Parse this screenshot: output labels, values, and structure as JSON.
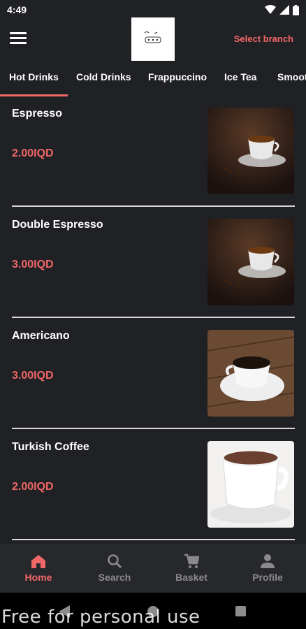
{
  "status": {
    "time": "4:49"
  },
  "header": {
    "branch_link": "Select branch"
  },
  "tabs": [
    {
      "label": "Hot Drinks"
    },
    {
      "label": "Cold Drinks"
    },
    {
      "label": "Frappuccino"
    },
    {
      "label": "Ice Tea"
    },
    {
      "label": "Smoot"
    }
  ],
  "items": [
    {
      "name": "Espresso",
      "price": "2.00IQD",
      "image": "espresso-cup-icon"
    },
    {
      "name": "Double Espresso",
      "price": "3.00IQD",
      "image": "espresso-cup-icon"
    },
    {
      "name": "Americano",
      "price": "3.00IQD",
      "image": "americano-cup-icon"
    },
    {
      "name": "Turkish Coffee",
      "price": "2.00IQD",
      "image": "turkish-coffee-cup-icon"
    }
  ],
  "bottom_nav": [
    {
      "label": "Home",
      "icon": "home-icon"
    },
    {
      "label": "Search",
      "icon": "search-icon"
    },
    {
      "label": "Basket",
      "icon": "cart-icon"
    },
    {
      "label": "Profile",
      "icon": "person-icon"
    }
  ],
  "colors": {
    "accent": "#f06767",
    "background": "#202125",
    "nav_inactive": "#8a8a8e"
  },
  "watermark": "Free for personal use"
}
